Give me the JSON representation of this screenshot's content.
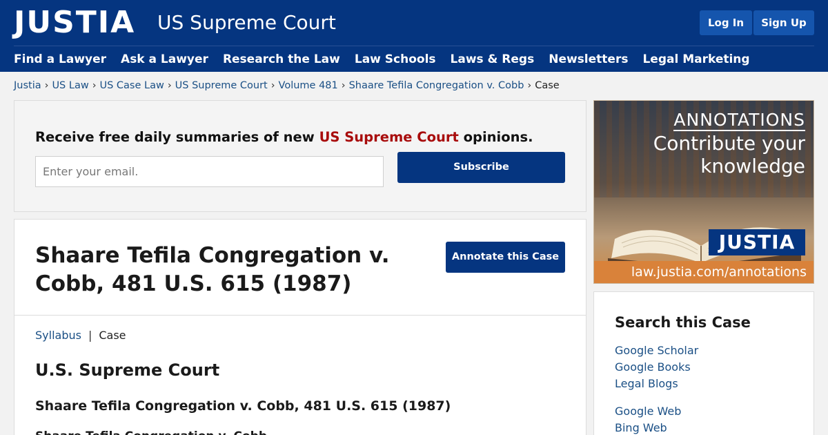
{
  "header": {
    "logo": "JUSTIA",
    "section_title": "US Supreme Court",
    "login_label": "Log In",
    "signup_label": "Sign Up",
    "nav": [
      "Find a Lawyer",
      "Ask a Lawyer",
      "Research the Law",
      "Law Schools",
      "Laws & Regs",
      "Newsletters",
      "Legal Marketing"
    ]
  },
  "breadcrumb": {
    "links": [
      "Justia",
      "US Law",
      "US Case Law",
      "US Supreme Court",
      "Volume 481",
      "Shaare Tefila Congregation v. Cobb"
    ],
    "separator": "›",
    "current": "Case"
  },
  "newsletter": {
    "text_prefix": "Receive free daily summaries of new ",
    "text_highlight": "US Supreme Court",
    "text_suffix": " opinions.",
    "email_placeholder": "Enter your email.",
    "subscribe_label": "Subscribe"
  },
  "case": {
    "title": "Shaare Tefila Congregation v. Cobb, 481 U.S. 615 (1987)",
    "annotate_label": "Annotate this Case",
    "tab_syllabus": "Syllabus",
    "tab_separator": "|",
    "tab_case": "Case",
    "court": "U.S. Supreme Court",
    "subheading": "Shaare Tefila Congregation v. Cobb, 481 U.S. 615 (1987)",
    "subheading2": "Shaare Tefila Congregation v. Cobb"
  },
  "ad": {
    "heading": "ANNOTATIONS",
    "line1": "Contribute your",
    "line2": "knowledge",
    "badge": "JUSTIA",
    "url": "law.justia.com/annotations"
  },
  "search": {
    "title": "Search this Case",
    "group1": [
      "Google Scholar",
      "Google Books",
      "Legal Blogs"
    ],
    "group2": [
      "Google Web",
      "Bing Web"
    ]
  },
  "colors": {
    "brand_navy": "#053580",
    "link_blue": "#1a4f85",
    "highlight_red": "#a80c0c",
    "ad_orange": "#d9823a"
  }
}
